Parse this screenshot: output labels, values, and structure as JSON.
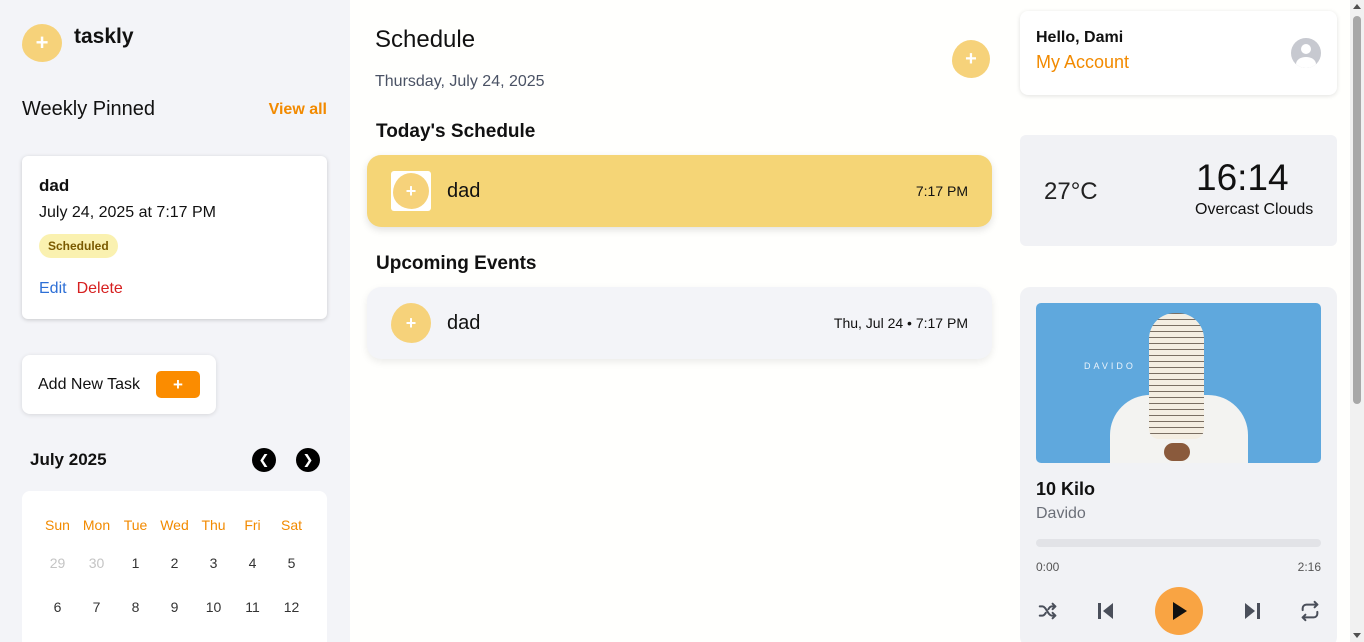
{
  "app": {
    "name": "taskly"
  },
  "sidebar": {
    "pinned_title": "Weekly Pinned",
    "view_all": "View all",
    "pinned_task": {
      "title": "dad",
      "datetime": "July 24, 2025 at 7:17 PM",
      "status": "Scheduled",
      "edit_label": "Edit",
      "delete_label": "Delete"
    },
    "add_task_label": "Add New Task",
    "add_task_button": "+",
    "calendar": {
      "title": "July 2025",
      "weekdays": [
        "Sun",
        "Mon",
        "Tue",
        "Wed",
        "Thu",
        "Fri",
        "Sat"
      ],
      "days": [
        {
          "d": "29",
          "muted": true
        },
        {
          "d": "30",
          "muted": true
        },
        {
          "d": "1"
        },
        {
          "d": "2"
        },
        {
          "d": "3"
        },
        {
          "d": "4"
        },
        {
          "d": "5"
        },
        {
          "d": "6"
        },
        {
          "d": "7"
        },
        {
          "d": "8"
        },
        {
          "d": "9"
        },
        {
          "d": "10"
        },
        {
          "d": "11"
        },
        {
          "d": "12"
        }
      ]
    }
  },
  "main": {
    "title": "Schedule",
    "date": "Thursday, July 24, 2025",
    "today_title": "Today's Schedule",
    "today_items": [
      {
        "name": "dad",
        "time": "7:17 PM"
      }
    ],
    "upcoming_title": "Upcoming Events",
    "upcoming_items": [
      {
        "name": "dad",
        "time": "Thu, Jul 24 • 7:17 PM"
      }
    ]
  },
  "account": {
    "greeting": "Hello, Dami",
    "link": "My Account"
  },
  "weather": {
    "temperature": "27°C",
    "time": "16:14",
    "condition": "Overcast Clouds"
  },
  "player": {
    "cover_text": "DAVIDO",
    "song": "10 Kilo",
    "artist": "Davido",
    "current_time": "0:00",
    "total_time": "2:16",
    "progress": 0
  },
  "colors": {
    "accent": "#f28a00",
    "brand_yellow": "#f6d27a",
    "delete": "#d62020",
    "edit": "#2d6fd6"
  }
}
